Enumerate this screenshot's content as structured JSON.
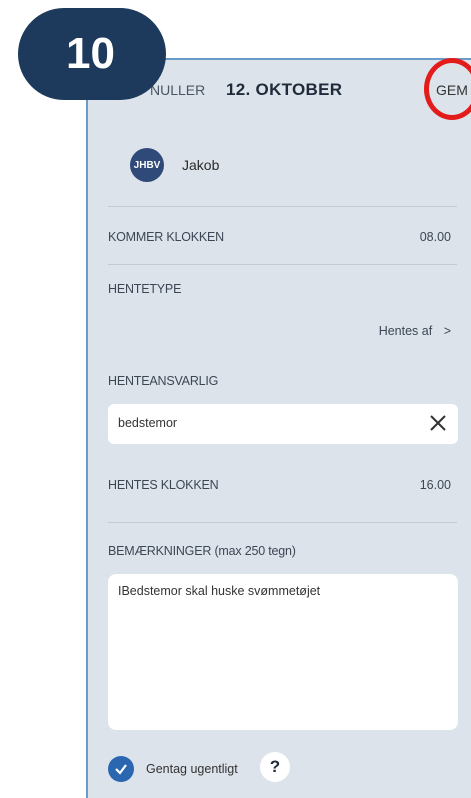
{
  "step_badge": "10",
  "header": {
    "cancel_label": "NULLER",
    "date_title": "12. OKTOBER",
    "save_label": "GEM"
  },
  "child": {
    "avatar_initials": "JHBV",
    "name": "Jakob"
  },
  "arrival": {
    "label": "KOMMER KLOKKEN",
    "value": "08.00"
  },
  "pickup_type": {
    "label": "HENTETYPE",
    "value": "Hentes af",
    "chevron": ">"
  },
  "pickup_person": {
    "label": "HENTEANSVARLIG",
    "value": "bedstemor"
  },
  "pickup_time": {
    "label": "HENTES KLOKKEN",
    "value": "16.00"
  },
  "remarks": {
    "label": "BEMÆRKNINGER (max 250 tegn)",
    "value": "IBedstemor skal huske svømmetøjet"
  },
  "repeat": {
    "label": "Gentag ugentligt",
    "checked": true,
    "help": "?"
  },
  "colors": {
    "badge": "#1d3a5c",
    "highlight_ring": "#e31b1b",
    "checkbox": "#2a67b0",
    "panel_bg": "#dde3ea"
  }
}
